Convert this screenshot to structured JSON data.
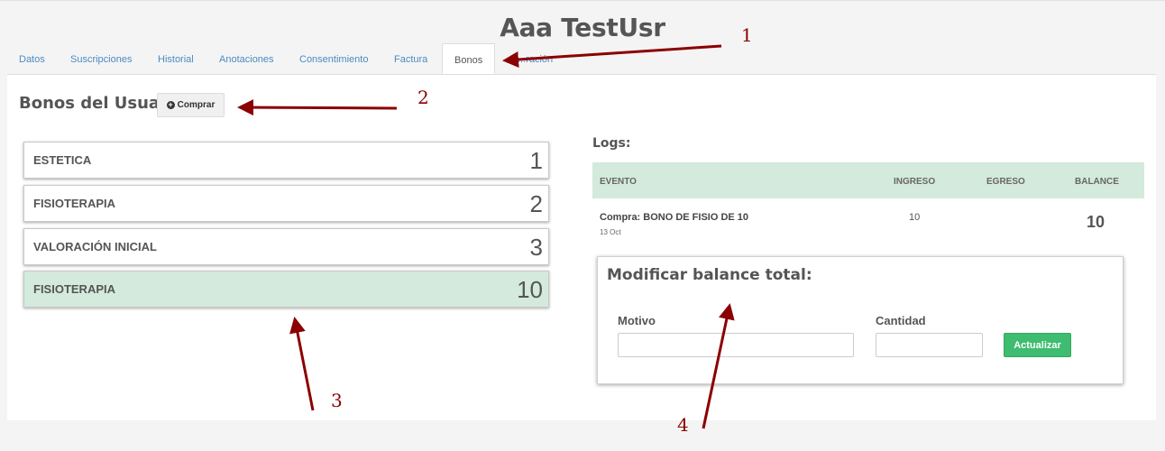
{
  "header": {
    "title": "Aaa TestUsr"
  },
  "tabs": [
    {
      "label": "Datos"
    },
    {
      "label": "Suscripciones"
    },
    {
      "label": "Historial"
    },
    {
      "label": "Anotaciones"
    },
    {
      "label": "Consentimiento"
    },
    {
      "label": "Factura"
    },
    {
      "label": "Bonos",
      "active": true
    },
    {
      "label": "...ración"
    }
  ],
  "bonos": {
    "title": "Bonos del Usuario",
    "buy_button": "Comprar",
    "items": [
      {
        "name": "ESTETICA",
        "count": "1"
      },
      {
        "name": "FISIOTERAPIA",
        "count": "2"
      },
      {
        "name": "VALORACIÓN INICIAL",
        "count": "3"
      },
      {
        "name": "FISIOTERAPIA",
        "count": "10",
        "selected": true
      }
    ]
  },
  "logs": {
    "label": "Logs:",
    "columns": [
      "EVENTO",
      "INGRESO",
      "EGRESO",
      "BALANCE"
    ],
    "rows": [
      {
        "evento": "Compra: BONO DE FISIO DE 10",
        "fecha": "13 Oct",
        "ingreso": "10",
        "egreso": "",
        "balance": "10"
      }
    ]
  },
  "modify_balance": {
    "title": "Modificar balance total:",
    "motivo_label": "Motivo",
    "motivo_value": "",
    "cantidad_label": "Cantidad",
    "cantidad_value": "",
    "submit_label": "Actualizar"
  },
  "annotations": [
    "1",
    "2",
    "3",
    "4"
  ],
  "colors": {
    "accent_green": "#3ebc70",
    "selected_row": "#d4eadc",
    "link": "#4a8bc4",
    "annotation": "#8b0000"
  }
}
